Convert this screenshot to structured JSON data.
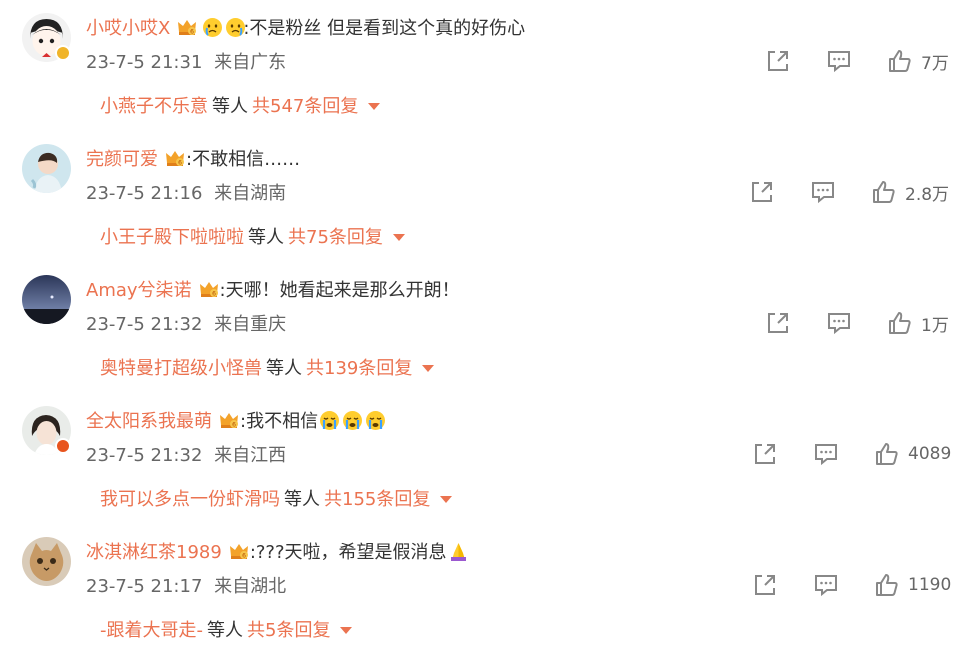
{
  "comments": [
    {
      "username": "小哎小哎X",
      "text": ":不是粉丝  但是看到这个真的好伤心",
      "emojis": [
        "crying-emoji",
        "crying-emoji"
      ],
      "time": "23-7-5 21:31",
      "location": "来自广东",
      "likes": "7万",
      "reply_user": "小燕子不乐意",
      "reply_mid": "等人",
      "reply_total": "共547条回复",
      "badge_color": "#f0b429"
    },
    {
      "username": "完颜可爱",
      "text": ":不敢相信……",
      "emojis": [],
      "time": "23-7-5 21:16",
      "location": "来自湖南",
      "likes": "2.8万",
      "reply_user": "小王子殿下啦啦啦",
      "reply_mid": "等人",
      "reply_total": "共75条回复",
      "badge_color": ""
    },
    {
      "username": "Amay兮柒诺",
      "text": ":天哪！她看起来是那么开朗！",
      "emojis": [],
      "time": "23-7-5 21:32",
      "location": "来自重庆",
      "likes": "1万",
      "reply_user": "奥特曼打超级小怪兽",
      "reply_mid": "等人",
      "reply_total": "共139条回复",
      "badge_color": ""
    },
    {
      "username": "全太阳系我最萌",
      "text": ":我不相信",
      "emojis": [
        "crying-emoji",
        "crying-emoji",
        "crying-emoji"
      ],
      "time": "23-7-5 21:32",
      "location": "来自江西",
      "likes": "4089",
      "reply_user": "我可以多点一份虾滑吗",
      "reply_mid": "等人",
      "reply_total": "共155条回复",
      "badge_color": "#e8541e"
    },
    {
      "username": "冰淇淋红茶1989",
      "text": ":???天啦，希望是假消息",
      "emojis": [
        "praying-emoji"
      ],
      "time": "23-7-5 21:17",
      "location": "来自湖北",
      "likes": "1190",
      "reply_user": "-跟着大哥走-",
      "reply_mid": "等人",
      "reply_total": "共5条回复",
      "badge_color": ""
    }
  ],
  "colors": {
    "accent": "#eb7350",
    "text": "#333333",
    "meta": "#666666",
    "icon": "#888888"
  }
}
